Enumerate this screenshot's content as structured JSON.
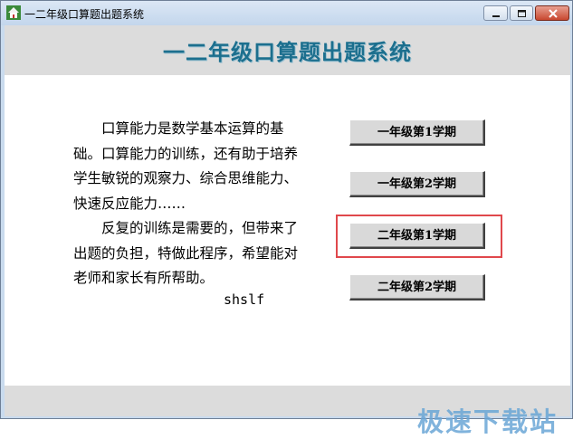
{
  "window": {
    "title": "一二年级口算题出题系统"
  },
  "header": {
    "title": "一二年级口算题出题系统"
  },
  "intro": {
    "paragraph1": "口算能力是数学基本运算的基础。口算能力的训练，还有助于培养学生敏锐的观察力、综合思维能力、快速反应能力……",
    "paragraph2": "反复的训练是需要的，但带来了出题的负担，特做此程序，希望能对老师和家长有所帮助。",
    "author": "shslf"
  },
  "buttons": [
    {
      "label": "一年级第1学期"
    },
    {
      "label": "一年级第2学期"
    },
    {
      "label": "二年级第1学期"
    },
    {
      "label": "二年级第2学期"
    }
  ],
  "highlighted_button": "二年级第1学期",
  "watermark": "极速下载站",
  "icons": {
    "app": "house-icon",
    "minimize": "minimize-icon",
    "maximize": "maximize-icon",
    "close": "close-icon"
  },
  "colors": {
    "header_title": "#1c6f8e",
    "highlight_border": "#e0484c",
    "band_gray": "#dcdcdc"
  }
}
